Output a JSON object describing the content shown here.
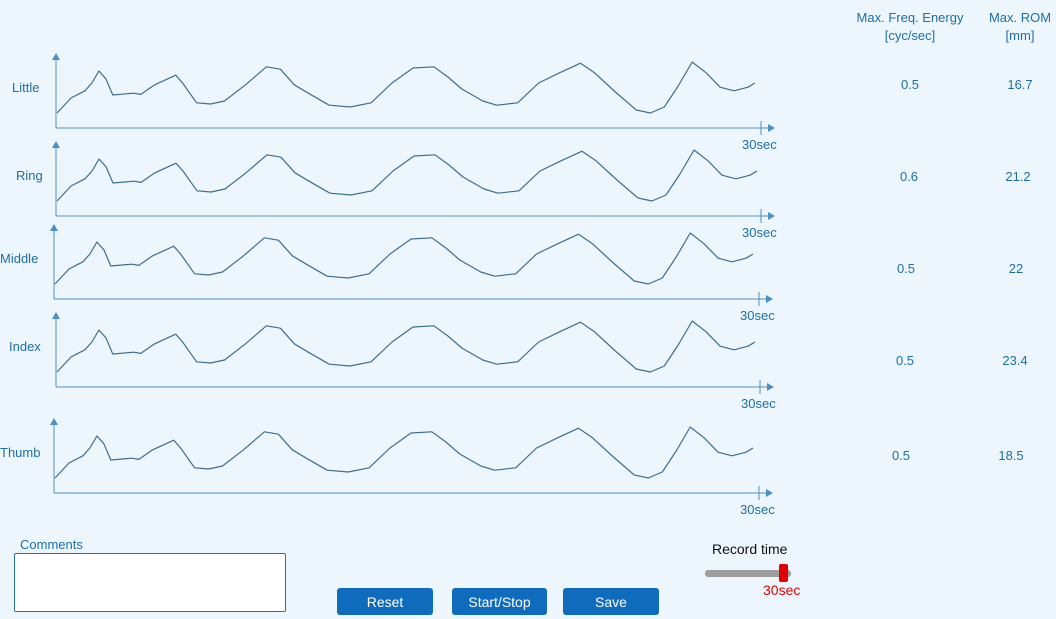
{
  "headers": {
    "freq_line1": "Max. Freq. Energy",
    "freq_line2": "[cyc/sec]",
    "rom_line1": "Max. ROM",
    "rom_line2": "[mm]"
  },
  "rows": [
    {
      "label": "Little",
      "freq": "0.5",
      "rom": "16.7",
      "time_label": "30sec"
    },
    {
      "label": "Ring",
      "freq": "0.6",
      "rom": "21.2",
      "time_label": "30sec"
    },
    {
      "label": "Middle",
      "freq": "0.5",
      "rom": "22",
      "time_label": "30sec"
    },
    {
      "label": "Index",
      "freq": "0.5",
      "rom": "23.4",
      "time_label": "30sec"
    },
    {
      "label": "Thumb",
      "freq": "0.5",
      "rom": "18.5",
      "time_label": "30sec"
    }
  ],
  "comments": {
    "label": "Comments",
    "value": ""
  },
  "buttons": {
    "reset": "Reset",
    "start_stop": "Start/Stop",
    "save": "Save"
  },
  "record": {
    "label": "Record time",
    "value": "30sec",
    "level": 0.86
  },
  "colors": {
    "accent": "#0f6cbd",
    "axis": "#4a90c8",
    "trace": "#3a6e92",
    "record_value": "#e00000"
  },
  "waveform": [
    [
      0.0,
      0.05
    ],
    [
      0.02,
      0.3
    ],
    [
      0.04,
      0.42
    ],
    [
      0.05,
      0.55
    ],
    [
      0.06,
      0.75
    ],
    [
      0.07,
      0.62
    ],
    [
      0.08,
      0.35
    ],
    [
      0.11,
      0.38
    ],
    [
      0.12,
      0.36
    ],
    [
      0.14,
      0.52
    ],
    [
      0.17,
      0.68
    ],
    [
      0.18,
      0.55
    ],
    [
      0.2,
      0.22
    ],
    [
      0.22,
      0.2
    ],
    [
      0.24,
      0.25
    ],
    [
      0.27,
      0.52
    ],
    [
      0.3,
      0.82
    ],
    [
      0.32,
      0.78
    ],
    [
      0.34,
      0.52
    ],
    [
      0.36,
      0.38
    ],
    [
      0.39,
      0.18
    ],
    [
      0.42,
      0.15
    ],
    [
      0.45,
      0.22
    ],
    [
      0.48,
      0.55
    ],
    [
      0.51,
      0.8
    ],
    [
      0.54,
      0.82
    ],
    [
      0.56,
      0.65
    ],
    [
      0.58,
      0.45
    ],
    [
      0.61,
      0.25
    ],
    [
      0.63,
      0.18
    ],
    [
      0.66,
      0.22
    ],
    [
      0.69,
      0.55
    ],
    [
      0.72,
      0.72
    ],
    [
      0.75,
      0.88
    ],
    [
      0.77,
      0.72
    ],
    [
      0.8,
      0.4
    ],
    [
      0.83,
      0.1
    ],
    [
      0.85,
      0.05
    ],
    [
      0.87,
      0.15
    ],
    [
      0.89,
      0.5
    ],
    [
      0.91,
      0.9
    ],
    [
      0.93,
      0.72
    ],
    [
      0.95,
      0.48
    ],
    [
      0.97,
      0.42
    ],
    [
      0.99,
      0.48
    ],
    [
      1.0,
      0.55
    ]
  ]
}
